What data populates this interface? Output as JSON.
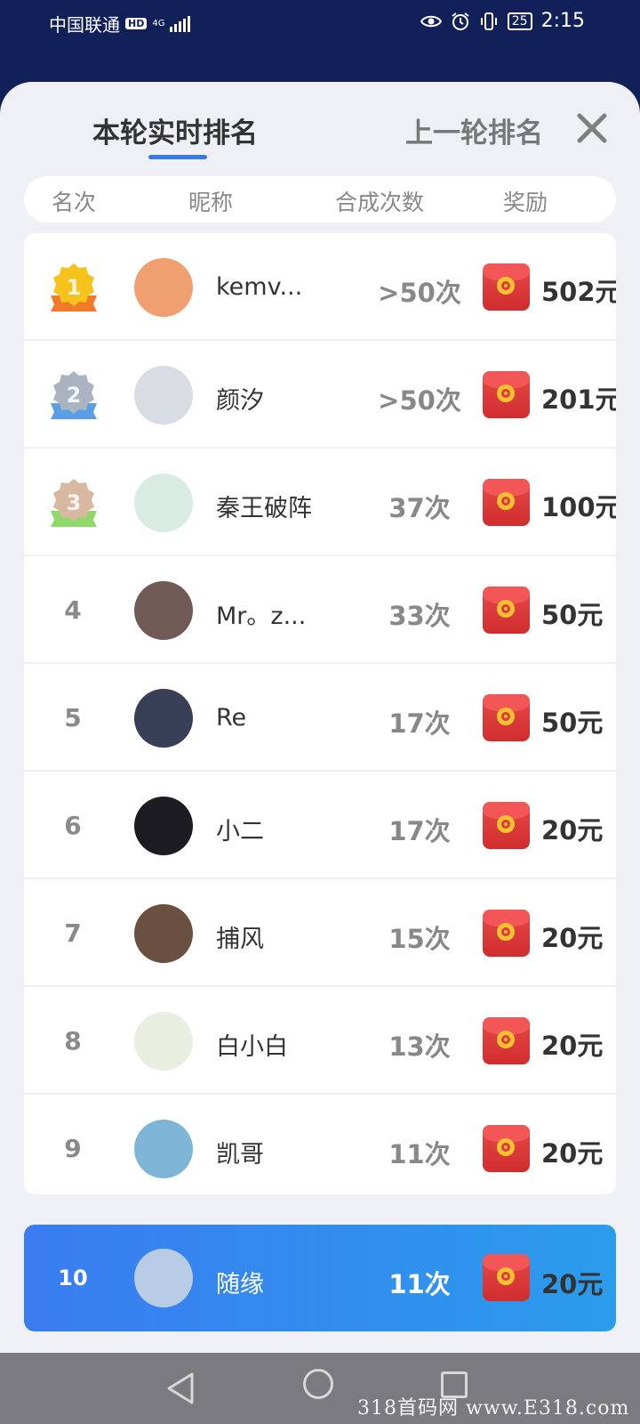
{
  "status_bar": {
    "carrier": "中国联通",
    "hd": "HD",
    "network": "4G",
    "battery": "25",
    "time": "2:15"
  },
  "tabs": {
    "current": "本轮实时排名",
    "previous": "上一轮排名"
  },
  "columns": {
    "rank": "名次",
    "nickname": "昵称",
    "count": "合成次数",
    "reward": "奖励"
  },
  "rows": [
    {
      "rank": "1",
      "nickname": "kemv...",
      "count": ">50次",
      "reward": "502元"
    },
    {
      "rank": "2",
      "nickname": "颜汐",
      "count": ">50次",
      "reward": "201元"
    },
    {
      "rank": "3",
      "nickname": "秦王破阵",
      "count": "37次",
      "reward": "100元"
    },
    {
      "rank": "4",
      "nickname": "Mr。z...",
      "count": "33次",
      "reward": "50元"
    },
    {
      "rank": "5",
      "nickname": "Re",
      "count": "17次",
      "reward": "50元"
    },
    {
      "rank": "6",
      "nickname": "小二",
      "count": "17次",
      "reward": "20元"
    },
    {
      "rank": "7",
      "nickname": "捕风",
      "count": "15次",
      "reward": "20元"
    },
    {
      "rank": "8",
      "nickname": "白小白",
      "count": "13次",
      "reward": "20元"
    },
    {
      "rank": "9",
      "nickname": "凯哥",
      "count": "11次",
      "reward": "20元"
    }
  ],
  "my_rank": {
    "rank": "10",
    "nickname": "随缘",
    "count": "11次",
    "reward": "20元"
  },
  "medals": [
    {
      "number": "1",
      "color": "#f6c21c",
      "ribbon": "#f07a2a"
    },
    {
      "number": "2",
      "color": "#aab3bf",
      "ribbon": "#5b9ee8"
    },
    {
      "number": "3",
      "color": "#d9b8a0",
      "ribbon": "#8fd96a"
    }
  ],
  "avatar_colors": [
    "#f0a070",
    "#d8dde4",
    "#d8ece4",
    "#6f5a55",
    "#3a3f58",
    "#1c1c22",
    "#6b5040",
    "#e8efe0",
    "#7fb6d8",
    "#b8cce6"
  ],
  "colors": {
    "header_bg": "#12205a",
    "accent_blue": "#3a78e6",
    "my_row_gradient_start": "#3a7cf0",
    "my_row_gradient_end": "#2b9cec",
    "red_packet": "#e23a3a"
  },
  "watermark": "318首码网 www.E318.com"
}
